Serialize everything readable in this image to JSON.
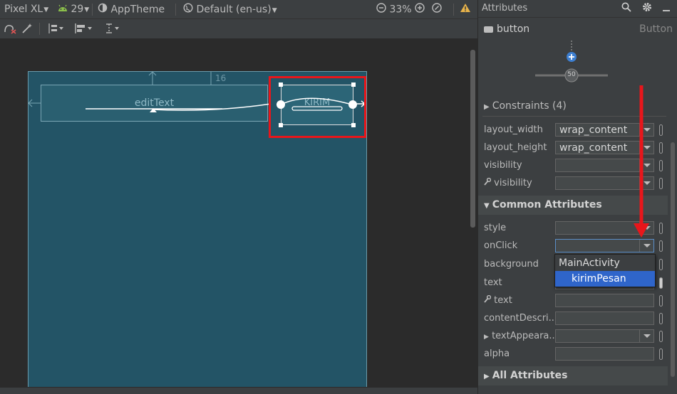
{
  "toolbar": {
    "device": "Pixel XL",
    "api_level": "29",
    "theme": "AppTheme",
    "locale": "Default (en-us)",
    "zoom": "33%"
  },
  "canvas": {
    "edit_text_label": "editText",
    "button_label": "KIRIM",
    "margin_label": "16"
  },
  "attributes_panel": {
    "title": "Attributes",
    "component_name": "button",
    "component_type": "Button",
    "bias_value": "50",
    "constraints_label": "Constraints (4)",
    "layout_width_label": "layout_width",
    "layout_width_value": "wrap_content",
    "layout_height_label": "layout_height",
    "layout_height_value": "wrap_content",
    "visibility_label": "visibility",
    "tools_visibility_label": "visibility",
    "common_attributes_label": "Common Attributes",
    "style_label": "style",
    "onclick_label": "onClick",
    "background_label": "background",
    "text_label": "text",
    "tools_text_label": "text",
    "content_description_label": "contentDescri...",
    "text_appearance_label": "textAppeara...",
    "alpha_label": "alpha",
    "all_attributes_label": "All Attributes"
  },
  "onclick_dropdown": {
    "header_option": "MainActivity",
    "selected_option": "kirimPesan"
  },
  "colors": {
    "selection_highlight": "#e8161b",
    "dropdown_selected": "#2f65ca",
    "blueprint_bg": "#235466"
  }
}
